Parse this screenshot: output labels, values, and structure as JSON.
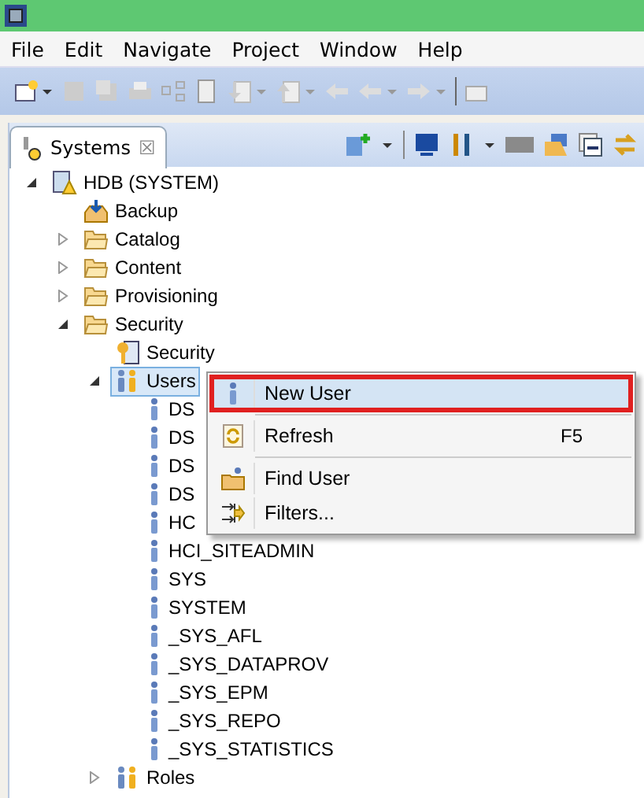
{
  "menu_bar": [
    "File",
    "Edit",
    "Navigate",
    "Project",
    "Window",
    "Help"
  ],
  "view_tab": {
    "label": "Systems",
    "close": "☒"
  },
  "tree": [
    {
      "label": "HDB (SYSTEM)",
      "kind": "system",
      "expanded": true,
      "children": [
        {
          "label": "Backup",
          "kind": "backup"
        },
        {
          "label": "Catalog",
          "kind": "folder",
          "expanded": false
        },
        {
          "label": "Content",
          "kind": "folder",
          "expanded": false
        },
        {
          "label": "Provisioning",
          "kind": "folder",
          "expanded": false
        },
        {
          "label": "Security",
          "kind": "folder",
          "expanded": true,
          "children": [
            {
              "label": "Security",
              "kind": "security"
            },
            {
              "label": "Users",
              "kind": "users",
              "expanded": true,
              "selected": true,
              "children": [
                {
                  "label": "DS",
                  "kind": "user"
                },
                {
                  "label": "DS",
                  "kind": "user"
                },
                {
                  "label": "DS",
                  "kind": "user"
                },
                {
                  "label": "DS",
                  "kind": "user"
                },
                {
                  "label": "HC",
                  "kind": "user"
                },
                {
                  "label": "HCI_SITEADMIN",
                  "kind": "user"
                },
                {
                  "label": "SYS",
                  "kind": "user"
                },
                {
                  "label": "SYSTEM",
                  "kind": "user"
                },
                {
                  "label": "_SYS_AFL",
                  "kind": "user"
                },
                {
                  "label": "_SYS_DATAPROV",
                  "kind": "user"
                },
                {
                  "label": "_SYS_EPM",
                  "kind": "user"
                },
                {
                  "label": "_SYS_REPO",
                  "kind": "user"
                },
                {
                  "label": "_SYS_STATISTICS",
                  "kind": "user"
                }
              ]
            },
            {
              "label": "Roles",
              "kind": "users",
              "expanded": false
            }
          ]
        }
      ]
    }
  ],
  "context_menu": [
    {
      "label": "New User",
      "kind": "user",
      "selected": true,
      "highlighted": true
    },
    {
      "label": "Refresh",
      "kind": "refresh",
      "shortcut": "F5",
      "selected": false,
      "highlighted": false
    },
    {
      "label": "Find User",
      "kind": "find",
      "selected": false,
      "highlighted": false
    },
    {
      "label": "Filters...",
      "kind": "filter",
      "selected": false,
      "highlighted": false
    }
  ]
}
